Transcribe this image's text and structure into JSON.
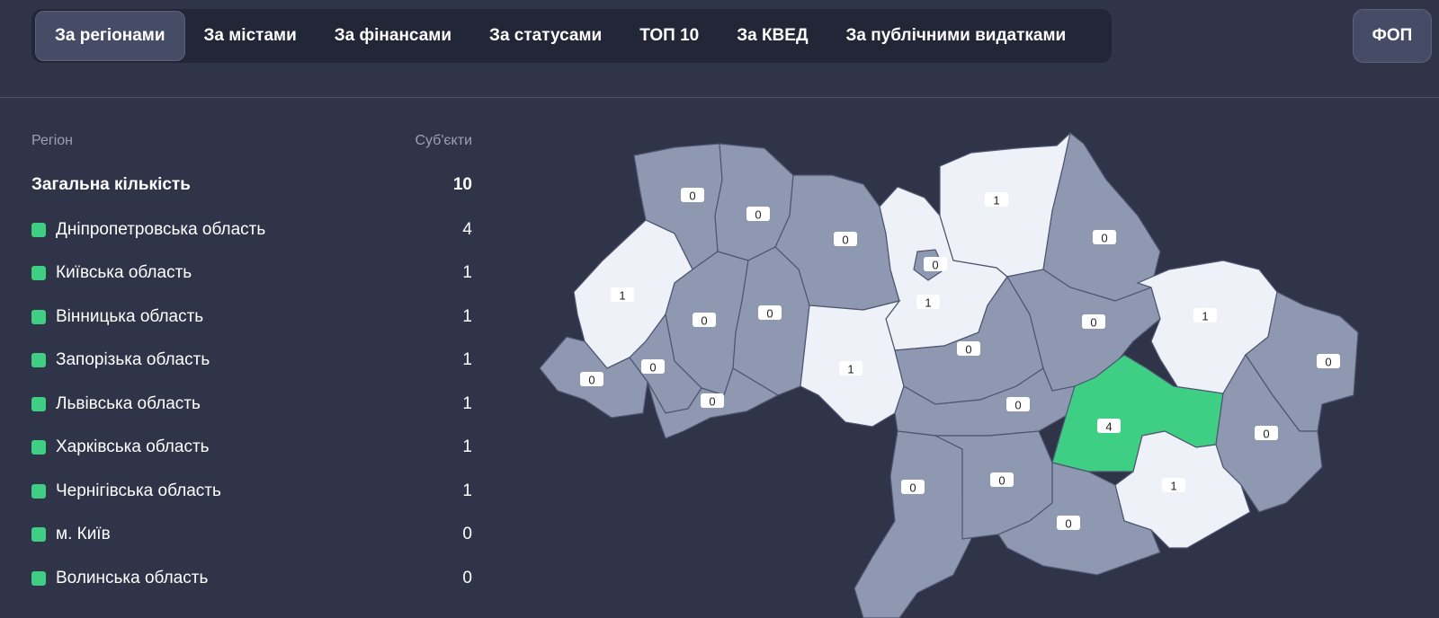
{
  "nav": {
    "tabs": [
      {
        "label": "За регіонами",
        "active": true
      },
      {
        "label": "За містами"
      },
      {
        "label": "За фінансами"
      },
      {
        "label": "За статусами"
      },
      {
        "label": "ТОП 10"
      },
      {
        "label": "За КВЕД"
      },
      {
        "label": "За публічними видатками"
      }
    ],
    "fop_label": "ФОП"
  },
  "table": {
    "col_region": "Регіон",
    "col_count": "Суб'єкти",
    "total_label": "Загальна кількість",
    "total_value": "10",
    "rows": [
      {
        "name": "Дніпропетровська область",
        "value": "4"
      },
      {
        "name": "Київська область",
        "value": "1"
      },
      {
        "name": "Вінницька область",
        "value": "1"
      },
      {
        "name": "Запорізька область",
        "value": "1"
      },
      {
        "name": "Львівська область",
        "value": "1"
      },
      {
        "name": "Харківська область",
        "value": "1"
      },
      {
        "name": "Чернігівська область",
        "value": "1"
      },
      {
        "name": "м. Київ",
        "value": "0"
      },
      {
        "name": "Волинська область",
        "value": "0"
      }
    ]
  },
  "colors": {
    "background": "#2f3449",
    "accent": "#3ecf84",
    "region_zero": "#8e98b0",
    "region_one": "#eef1f7",
    "region_max": "#3ecf84"
  },
  "map": {
    "regions": [
      {
        "id": "volyn",
        "value": "0"
      },
      {
        "id": "rivne",
        "value": "0"
      },
      {
        "id": "zhytomyr",
        "value": "0"
      },
      {
        "id": "kyiv-oblast",
        "value": "1"
      },
      {
        "id": "kyiv-city",
        "value": "0"
      },
      {
        "id": "chernihiv",
        "value": "1"
      },
      {
        "id": "sumy",
        "value": "0"
      },
      {
        "id": "lviv",
        "value": "1"
      },
      {
        "id": "ternopil",
        "value": "0"
      },
      {
        "id": "khmelnytskyi",
        "value": "0"
      },
      {
        "id": "vinnytsia",
        "value": "1"
      },
      {
        "id": "cherkasy",
        "value": "0"
      },
      {
        "id": "poltava",
        "value": "0"
      },
      {
        "id": "kharkiv",
        "value": "1"
      },
      {
        "id": "luhansk",
        "value": "0"
      },
      {
        "id": "zakarpattia",
        "value": "0"
      },
      {
        "id": "ivano-frankivsk",
        "value": "0"
      },
      {
        "id": "chernivtsi",
        "value": "0"
      },
      {
        "id": "kirovohrad",
        "value": "0"
      },
      {
        "id": "dnipropetrovsk",
        "value": "4"
      },
      {
        "id": "donetsk",
        "value": "0"
      },
      {
        "id": "zaporizhzhia",
        "value": "1"
      },
      {
        "id": "odesa",
        "value": "0"
      },
      {
        "id": "mykolaiv",
        "value": "0"
      },
      {
        "id": "kherson",
        "value": "0"
      }
    ]
  }
}
